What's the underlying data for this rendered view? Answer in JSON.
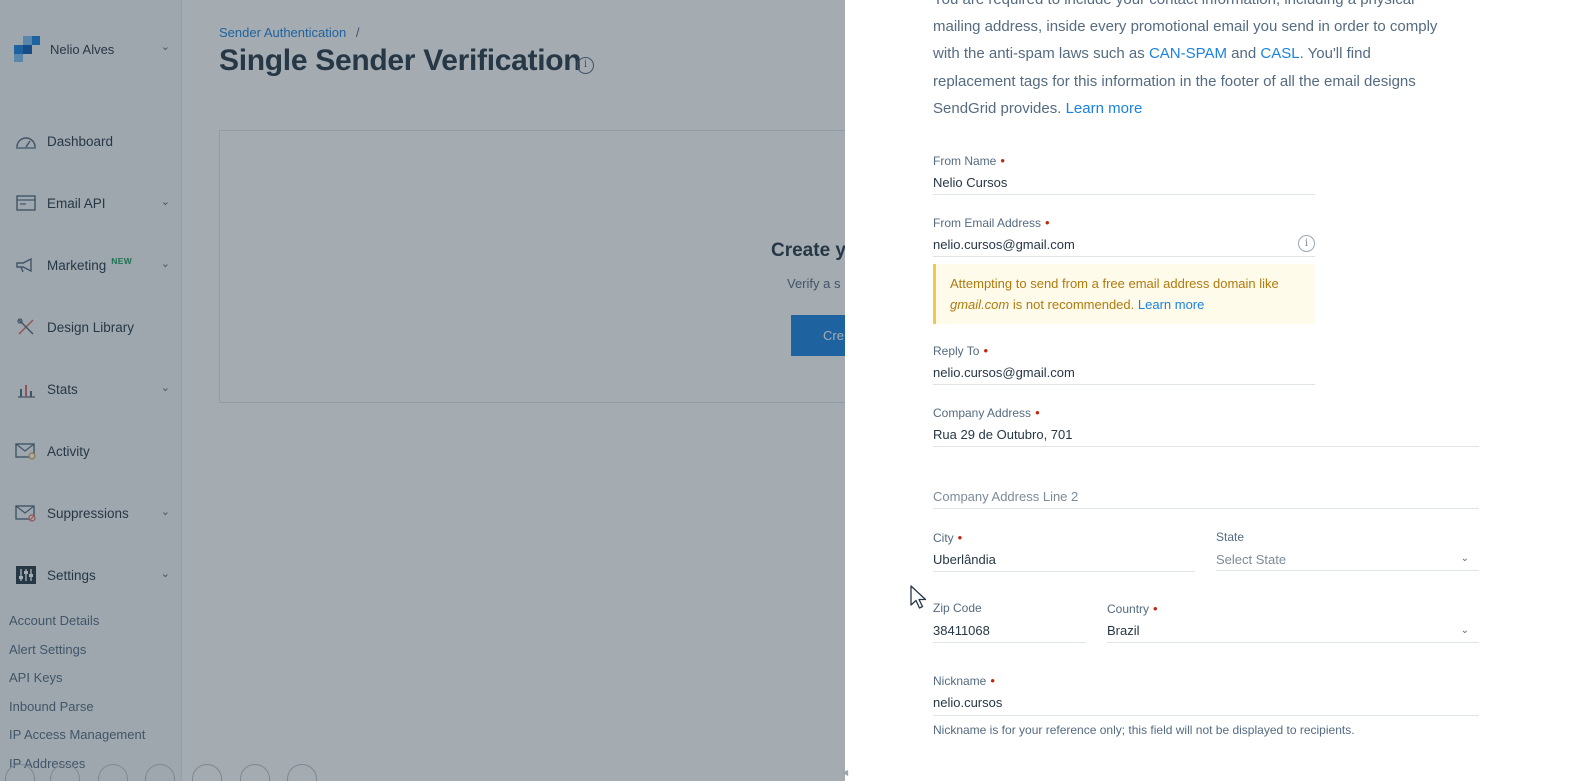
{
  "sidebar": {
    "account_name": "Nelio Alves",
    "nav": [
      {
        "label": "Dashboard",
        "icon": "dashboard-gauge-icon"
      },
      {
        "label": "Email API",
        "icon": "email-api-icon"
      },
      {
        "label": "Marketing",
        "icon": "megaphone-icon",
        "badge": "NEW"
      },
      {
        "label": "Design Library",
        "icon": "design-tools-icon"
      },
      {
        "label": "Stats",
        "icon": "bar-chart-icon"
      },
      {
        "label": "Activity",
        "icon": "activity-envelope-icon"
      },
      {
        "label": "Suppressions",
        "icon": "suppressions-envelope-icon"
      },
      {
        "label": "Settings",
        "icon": "settings-sliders-icon"
      }
    ],
    "settings_items": [
      "Account Details",
      "Alert Settings",
      "API Keys",
      "Inbound Parse",
      "IP Access Management",
      "IP Addresses"
    ]
  },
  "main": {
    "breadcrumb": "Sender Authentication",
    "breadcrumb_sep": "/",
    "title": "Single Sender Verification",
    "card_heading": "Create y",
    "card_sub": "Verify a s",
    "card_button": "Cre"
  },
  "drawer": {
    "intro": {
      "line1": "You are required to include your contact information, including a physical",
      "line2": "mailing address, inside every promotional email you send in order to comply",
      "line3_pre": "with the anti-spam laws such as ",
      "link_canspam": "CAN-SPAM",
      "and": " and ",
      "link_casl": "CASL",
      "line3_post": ". You'll find",
      "line4": "replacement tags for this information in the footer of all the email designs",
      "line5_pre": "SendGrid provides. ",
      "learn_more": "Learn more"
    },
    "fields": {
      "from_name": {
        "label": "From Name",
        "value": "Nelio Cursos"
      },
      "from_email": {
        "label": "From Email Address",
        "value": "nelio.cursos@gmail.com"
      },
      "reply_to": {
        "label": "Reply To",
        "value": "nelio.cursos@gmail.com"
      },
      "company_address": {
        "label": "Company Address",
        "value": "Rua 29 de Outubro, 701"
      },
      "company_address_2": {
        "placeholder": "Company Address Line 2"
      },
      "city": {
        "label": "City",
        "value": "Uberlândia"
      },
      "state": {
        "label": "State",
        "value": "Select State"
      },
      "zip": {
        "label": "Zip Code",
        "value": "38411068"
      },
      "country": {
        "label": "Country",
        "value": "Brazil"
      },
      "nickname": {
        "label": "Nickname",
        "value": "nelio.cursos"
      }
    },
    "warning": {
      "line1": "Attempting to send from a free email address domain like",
      "domain": "gmail.com",
      "line2": " is not recommended. ",
      "learn_more": "Learn more"
    },
    "nickname_hint": "Nickname is for your reference only; this field will not be displayed to recipients.",
    "required_mark": "•"
  },
  "colors": {
    "accent": "#1a82e2",
    "required": "#c3260f",
    "warning_bg": "#fffbeb",
    "warning_border": "#f2c94c"
  }
}
